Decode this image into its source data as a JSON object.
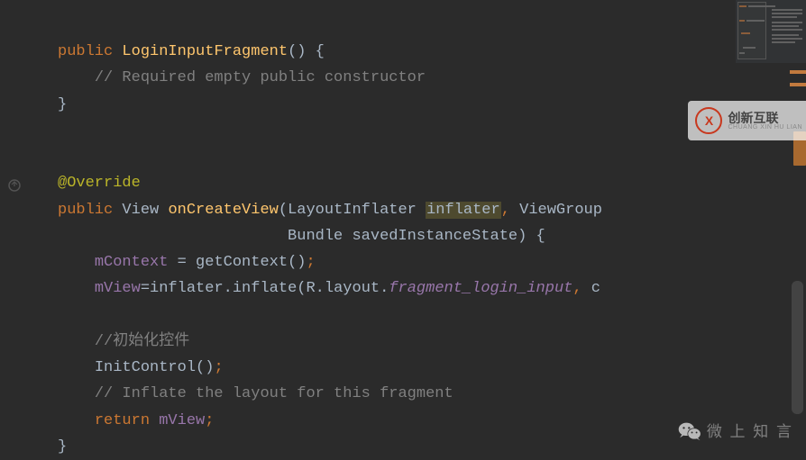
{
  "code": {
    "kw_public": "public",
    "ctor_name": "LoginInputFragment",
    "ctor_comment": "// Required empty public constructor",
    "anno_override": "@Override",
    "ret_type": "View",
    "fn_oncreateview": "onCreateView",
    "p1_type": "LayoutInflater",
    "p1_name": "inflater",
    "p2_type": "ViewGroup",
    "p3_type": "Bundle",
    "p3_name": "savedInstanceState",
    "stmt_mcontext_lhs": "mContext",
    "stmt_getcontext": "getContext",
    "stmt_mview_lhs": "mView",
    "stmt_inflater": "inflater",
    "stmt_inflate": "inflate",
    "r_layout_prefix": "R.layout.",
    "r_layout_name": "fragment_login_input",
    "inflate_tail": "c",
    "comment_init": "//初始化控件",
    "call_initcontrol": "InitControl",
    "comment_inflate": "// Inflate the layout for this fragment",
    "kw_return": "return",
    "ret_mview": "mView"
  },
  "watermarks": {
    "bottom_text": "微 上 知 言",
    "logo_letter": "X",
    "tr_cn": "创新互联",
    "tr_en": "CHUANG XIN HU LIAN"
  }
}
